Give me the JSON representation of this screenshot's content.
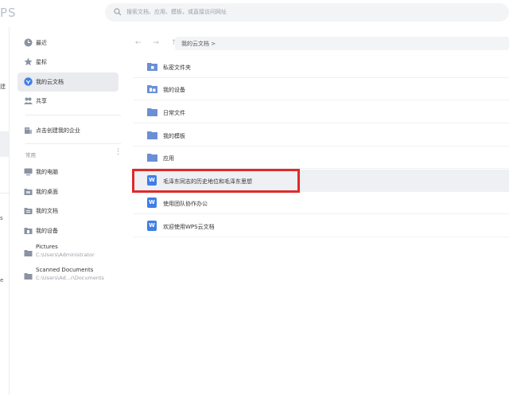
{
  "app": {
    "logo": "PS"
  },
  "search": {
    "placeholder": "搜索文档、应用、模板，或直接访问网址"
  },
  "leftrail": {
    "m1": "建",
    "m2": "s",
    "m3": "e"
  },
  "sidebar": {
    "items": [
      {
        "label": "最近",
        "icon": "clock-icon"
      },
      {
        "label": "星标",
        "icon": "star-icon"
      },
      {
        "label": "我的云文档",
        "icon": "cloud-icon",
        "selected": true
      },
      {
        "label": "共享",
        "icon": "people-icon"
      }
    ],
    "org": {
      "label": "点击创建我的企业",
      "icon": "building-icon"
    },
    "section": {
      "label": "常用",
      "more": "⋮"
    },
    "common": [
      {
        "label": "我的电脑",
        "icon": "computer-icon"
      },
      {
        "label": "我的桌面",
        "icon": "desktop-icon"
      },
      {
        "label": "我的文档",
        "icon": "documents-icon"
      },
      {
        "label": "我的设备",
        "icon": "device-icon"
      },
      {
        "label": "Pictures",
        "path": "C:\\Users\\Administrator",
        "icon": "folder-icon"
      },
      {
        "label": "Scanned Documents",
        "path": "C:\\Users\\Ad...r\\Documents",
        "icon": "folder-icon"
      }
    ]
  },
  "main": {
    "nav": "← → ↑",
    "breadcrumb": "我的云文档 >",
    "files": [
      {
        "label": "私密文件夹",
        "type": "folder-lock"
      },
      {
        "label": "我的设备",
        "type": "folder-device"
      },
      {
        "label": "日常文件",
        "type": "folder"
      },
      {
        "label": "我的模板",
        "type": "folder"
      },
      {
        "label": "应用",
        "type": "folder"
      },
      {
        "label": "毛泽东同志的历史地位和毛泽东思想",
        "type": "wps-doc",
        "glyph": "W"
      },
      {
        "label": "使用团队协作办公",
        "type": "wps-doc",
        "glyph": "W"
      },
      {
        "label": "欢迎使用WPS云文档",
        "type": "wps-doc",
        "glyph": "W"
      }
    ]
  },
  "colors": {
    "accent": "#3f7ee8",
    "folder": "#6b8fd6",
    "highlight": "#e02a2a"
  }
}
